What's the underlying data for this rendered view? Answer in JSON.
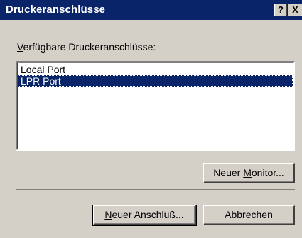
{
  "window": {
    "title": "Druckeranschlüsse",
    "help_glyph": "?",
    "close_glyph": "X"
  },
  "label": {
    "pre": "",
    "accel": "V",
    "post": "erfügbare Druckeranschlüsse:"
  },
  "ports": [
    {
      "name": "Local Port",
      "selected": false
    },
    {
      "name": "LPR Port",
      "selected": true
    }
  ],
  "buttons": {
    "new_monitor": {
      "pre": "Neuer ",
      "accel": "M",
      "post": "onitor..."
    },
    "new_port": {
      "pre": "",
      "accel": "N",
      "post": "euer Anschluß..."
    },
    "cancel": "Abbrechen"
  }
}
